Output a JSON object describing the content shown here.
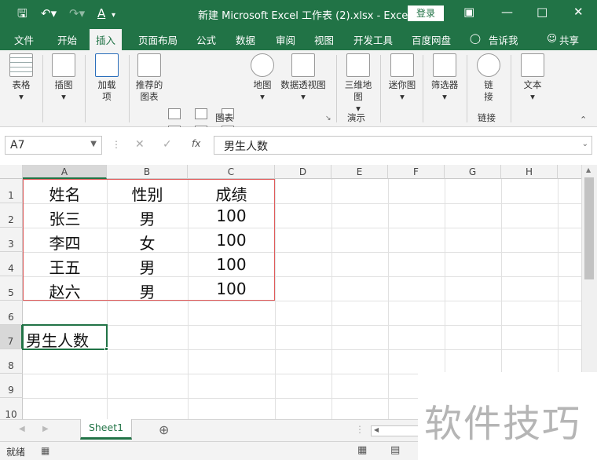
{
  "window": {
    "title": "新建 Microsoft Excel 工作表 (2).xlsx  -  Excel",
    "login_label": "登录",
    "accent_color": "#217346"
  },
  "ribbon_tabs": [
    "文件",
    "开始",
    "插入",
    "页面布局",
    "公式",
    "数据",
    "审阅",
    "视图",
    "开发工具",
    "百度网盘",
    "告诉我",
    "共享"
  ],
  "active_tab": "插入",
  "ribbon": {
    "table": "表格",
    "illustrations": "插图",
    "addins": "加载项",
    "recommended_charts": "推荐的图表",
    "maps": "地图",
    "pivot_chart": "数据透视图",
    "charts_group": "图表",
    "3d_map": "三维地图",
    "demo_group": "演示",
    "sparklines": "迷你图",
    "filters": "筛选器",
    "link": "链接",
    "link_group": "链接",
    "text": "文本"
  },
  "formula_bar": {
    "name_box": "A7",
    "fx": "fx",
    "formula": "男生人数"
  },
  "columns": [
    "A",
    "B",
    "C",
    "D",
    "E",
    "F",
    "G",
    "H"
  ],
  "rows": [
    "1",
    "2",
    "3",
    "4",
    "5",
    "6",
    "7",
    "8",
    "9",
    "10"
  ],
  "cells": {
    "header": [
      "姓名",
      "性别",
      "成绩"
    ],
    "data": [
      [
        "张三",
        "男",
        "100"
      ],
      [
        "李四",
        "女",
        "100"
      ],
      [
        "王五",
        "男",
        "100"
      ],
      [
        "赵六",
        "男",
        "100"
      ]
    ],
    "a7": "男生人数"
  },
  "sheet_tab": "Sheet1",
  "status": "就绪",
  "watermark": "软件技巧"
}
